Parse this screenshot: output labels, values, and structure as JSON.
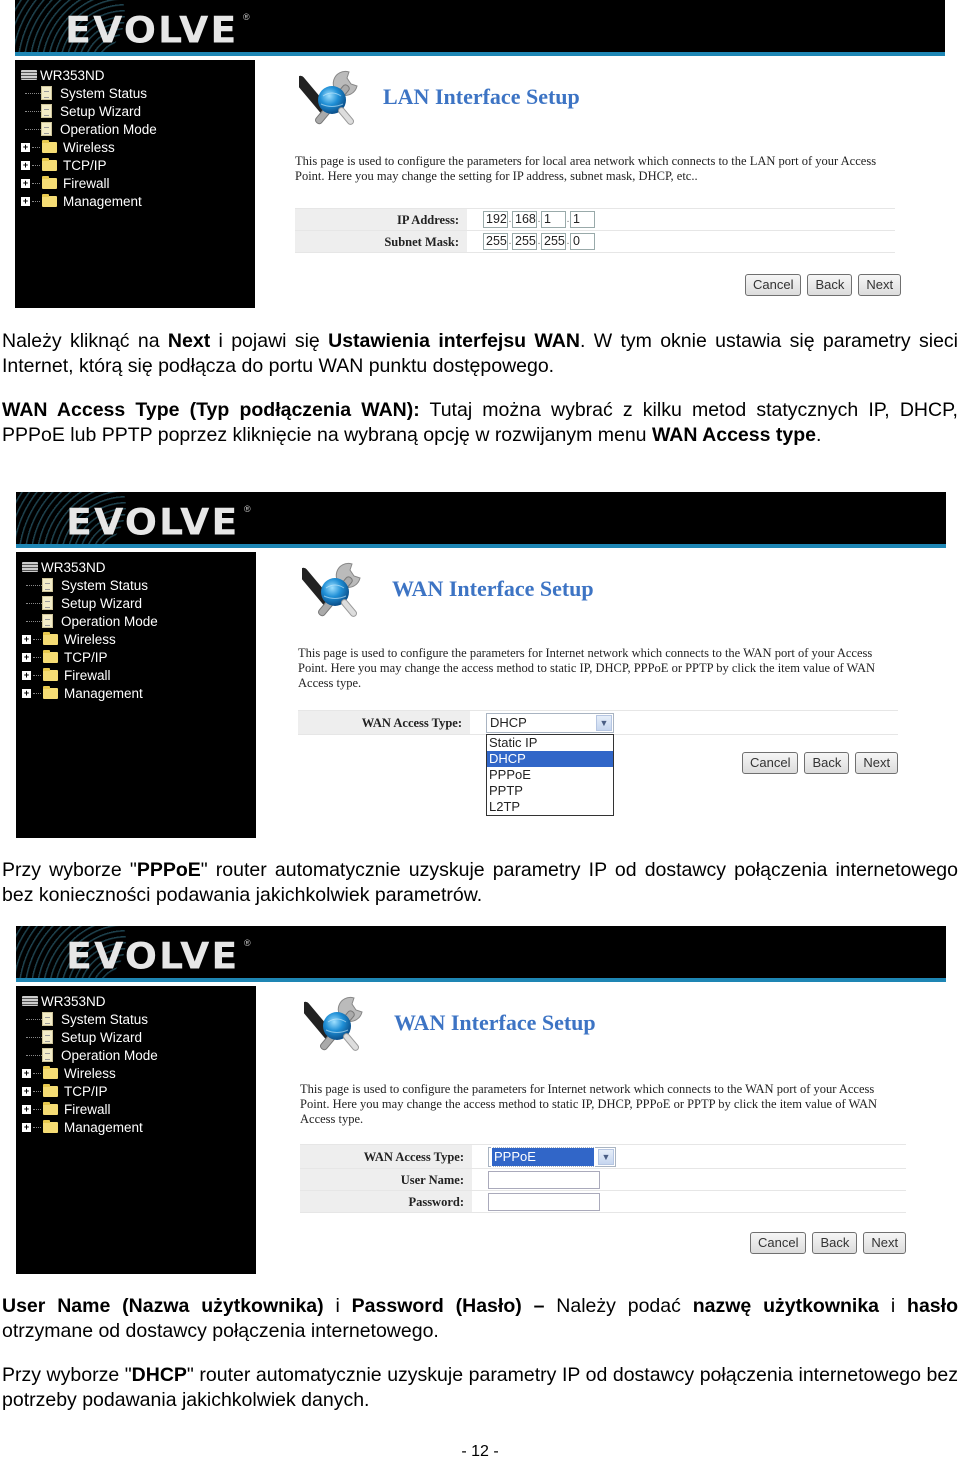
{
  "router_ui": {
    "brand_logo": "EVOLVE",
    "brand_reg": "®",
    "device_name": "WR353ND",
    "menu": [
      {
        "label": "System Status",
        "icon": "document-icon",
        "expandable": false
      },
      {
        "label": "Setup Wizard",
        "icon": "document-icon",
        "expandable": false
      },
      {
        "label": "Operation Mode",
        "icon": "document-icon",
        "expandable": false
      },
      {
        "label": "Wireless",
        "icon": "folder-icon",
        "expandable": true
      },
      {
        "label": "TCP/IP",
        "icon": "folder-icon",
        "expandable": true
      },
      {
        "label": "Firewall",
        "icon": "folder-icon",
        "expandable": true
      },
      {
        "label": "Management",
        "icon": "folder-icon",
        "expandable": true
      }
    ],
    "buttons": {
      "cancel": "Cancel",
      "back": "Back",
      "next": "Next"
    },
    "colors": {
      "header_bg": "#000000",
      "accent_bar": "#1e86b4",
      "title_blue": "#3d74c4",
      "select_highlight": "#3166c8"
    }
  },
  "screenshot1": {
    "title": "LAN Interface Setup",
    "description": "This page is used to configure the parameters for local area network which connects to the LAN port of your Access Point. Here you may change the setting for IP address, subnet mask, DHCP, etc..",
    "ip_label": "IP Address:",
    "ip_octets": [
      "192",
      "168",
      "1",
      "1"
    ],
    "mask_label": "Subnet Mask:",
    "mask_octets": [
      "255",
      "255",
      "255",
      "0"
    ]
  },
  "screenshot2": {
    "title": "WAN Interface Setup",
    "description": "This page is used to configure the parameters for Internet network which connects to the WAN port of your Access Point. Here you may change the access method to static IP, DHCP, PPPoE or PPTP by click the item value of WAN Access type.",
    "wan_label": "WAN Access Type:",
    "wan_selected": "DHCP",
    "wan_options": [
      "Static IP",
      "DHCP",
      "PPPoE",
      "PPTP",
      "L2TP"
    ],
    "highlighted_option": "DHCP"
  },
  "screenshot3": {
    "title": "WAN Interface Setup",
    "description": "This page is used to configure the parameters for Internet network which connects to the WAN port of your Access Point. Here you may change the access method to static IP, DHCP, PPPoE or PPTP by click the item value of WAN Access type.",
    "wan_label": "WAN Access Type:",
    "wan_selected": "PPPoE",
    "username_label": "User Name:",
    "username_value": "",
    "password_label": "Password:",
    "password_value": ""
  },
  "text": {
    "p1": [
      {
        "t": "Należy kliknąć na ",
        "b": false
      },
      {
        "t": "Next",
        "b": true
      },
      {
        "t": " i pojawi się ",
        "b": false
      },
      {
        "t": "Ustawienia interfejsu WAN",
        "b": true
      },
      {
        "t": ". W tym oknie ustawia się parametry sieci Internet, którą się podłącza do portu WAN punktu dostępowego.",
        "b": false
      }
    ],
    "p2": [
      {
        "t": "WAN Access Type (Typ podłączenia WAN):",
        "b": true
      },
      {
        "t": " Tutaj można wybrać z kilku metod statycznych IP, DHCP, PPPoE lub PPTP poprzez kliknięcie na wybraną opcję w rozwijanym menu ",
        "b": false
      },
      {
        "t": "WAN Access type",
        "b": true
      },
      {
        "t": ".",
        "b": false
      }
    ],
    "p3": [
      {
        "t": "Przy wyborze \"",
        "b": false
      },
      {
        "t": "PPPoE",
        "b": true
      },
      {
        "t": "\" router automatycznie uzyskuje parametry IP od dostawcy połączenia internetowego bez konieczności podawania jakichkolwiek parametrów.",
        "b": false
      }
    ],
    "p4": [
      {
        "t": "User Name (Nazwa użytkownika)",
        "b": true
      },
      {
        "t": " i ",
        "b": false
      },
      {
        "t": "Password (Hasło) –",
        "b": true
      },
      {
        "t": " Należy podać ",
        "b": false
      },
      {
        "t": "nazwę użytkownika",
        "b": true
      },
      {
        "t": " i ",
        "b": false
      },
      {
        "t": "hasło",
        "b": true
      },
      {
        "t": " otrzymane od dostawcy połączenia internetowego.",
        "b": false
      }
    ],
    "p5": [
      {
        "t": "Przy wyborze \"",
        "b": false
      },
      {
        "t": "DHCP",
        "b": true
      },
      {
        "t": "\" router automatycznie uzyskuje parametry IP od dostawcy połączenia internetowego bez potrzeby podawania jakichkolwiek danych.",
        "b": false
      }
    ],
    "page_number": "- 12 -"
  }
}
